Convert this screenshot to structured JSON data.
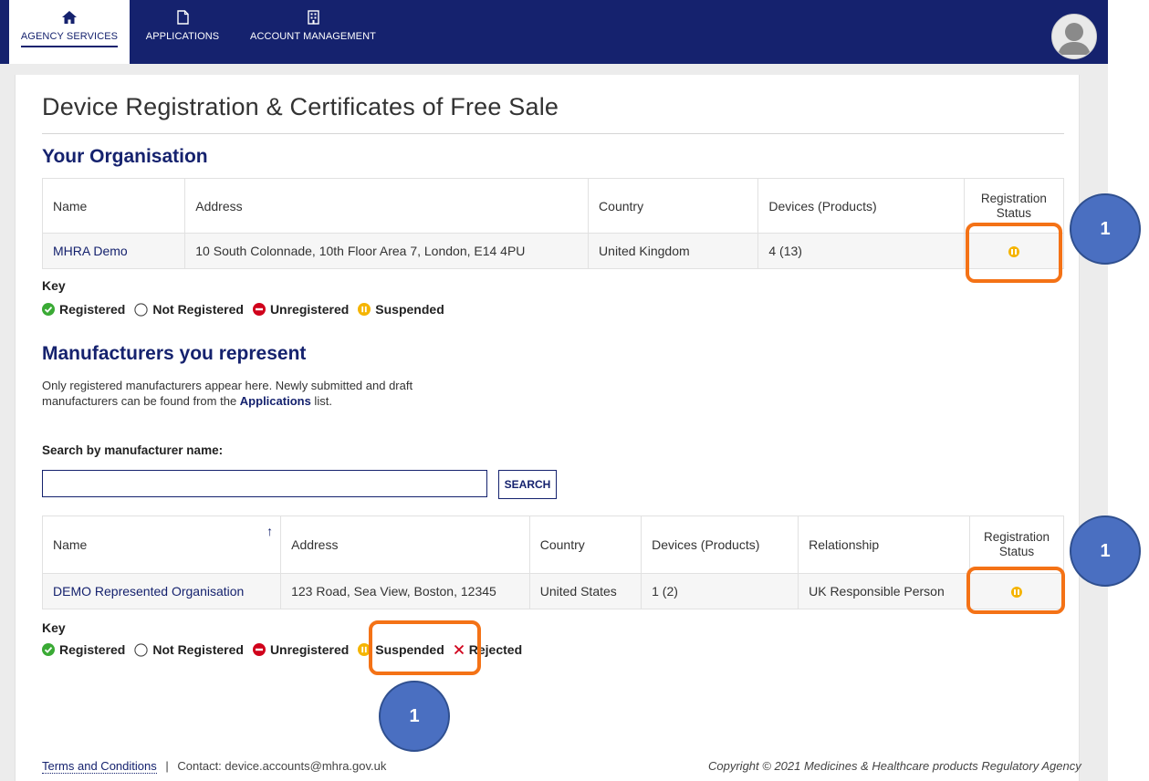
{
  "nav": {
    "items": [
      {
        "label": "AGENCY SERVICES",
        "icon": "home-icon"
      },
      {
        "label": "APPLICATIONS",
        "icon": "document-icon"
      },
      {
        "label": "ACCOUNT MANAGEMENT",
        "icon": "building-icon"
      }
    ],
    "active": "AGENCY SERVICES"
  },
  "page_title": "Device Registration & Certificates of Free Sale",
  "org": {
    "heading": "Your Organisation",
    "columns": [
      "Name",
      "Address",
      "Country",
      "Devices (Products)",
      "Registration Status"
    ],
    "rows": [
      {
        "name": "MHRA Demo",
        "address": "10 South Colonnade, 10th Floor Area 7, London, E14 4PU",
        "country": "United Kingdom",
        "devices": "4 (13)",
        "status": "Suspended"
      }
    ]
  },
  "key1": {
    "title": "Key",
    "items": [
      "Registered",
      "Not Registered",
      "Unregistered",
      "Suspended"
    ]
  },
  "manufacturers": {
    "heading": "Manufacturers you represent",
    "intro_before": "Only registered manufacturers appear here. Newly submitted and draft manufacturers can be found from the ",
    "intro_link": "Applications",
    "intro_after": " list.",
    "search_label": "Search by manufacturer name:",
    "search_value": "",
    "search_button": "SEARCH",
    "columns": [
      "Name",
      "Address",
      "Country",
      "Devices (Products)",
      "Relationship",
      "Registration Status"
    ],
    "rows": [
      {
        "name": "DEMO Represented Organisation",
        "address": "123 Road, Sea View, Boston, 12345",
        "country": "United States",
        "devices": "1 (2)",
        "relationship": "UK Responsible Person",
        "status": "Suspended"
      }
    ]
  },
  "key2": {
    "title": "Key",
    "items": [
      "Registered",
      "Not Registered",
      "Unregistered",
      "Suspended",
      "Rejected"
    ]
  },
  "annotations": {
    "badge_label": "1"
  },
  "footer": {
    "terms": "Terms and Conditions",
    "separator": "|",
    "contact": "Contact: device.accounts@mhra.gov.uk",
    "copyright": "Copyright © 2021 Medicines & Healthcare products Regulatory Agency"
  },
  "colors": {
    "brand": "#15226e",
    "suspended": "#f5b400",
    "registered": "#3aaa35",
    "unregistered": "#d0021b",
    "highlight": "#f47216",
    "badge": "#4a6fc1"
  }
}
